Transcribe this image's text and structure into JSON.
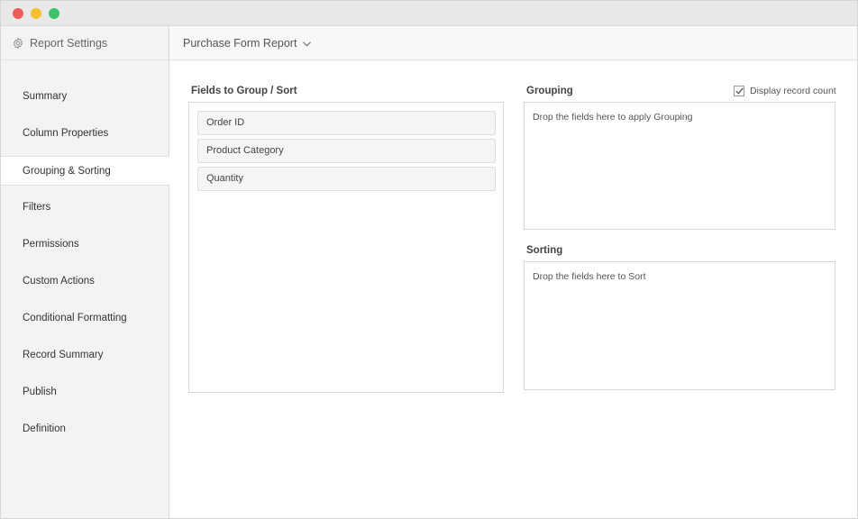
{
  "sidebar": {
    "title": "Report Settings",
    "icon": "gear-icon",
    "items": [
      {
        "label": "Summary"
      },
      {
        "label": "Column Properties"
      },
      {
        "label": "Grouping & Sorting",
        "active": true
      },
      {
        "label": "Filters"
      },
      {
        "label": "Permissions"
      },
      {
        "label": "Custom Actions"
      },
      {
        "label": "Conditional Formatting"
      },
      {
        "label": "Record Summary"
      },
      {
        "label": "Publish"
      },
      {
        "label": "Definition"
      }
    ]
  },
  "header": {
    "report_title": "Purchase Form Report"
  },
  "fields_panel": {
    "title": "Fields to Group / Sort",
    "fields": [
      "Order ID",
      "Product Category",
      "Quantity"
    ]
  },
  "grouping": {
    "title": "Grouping",
    "drop_hint": "Drop the fields here to apply Grouping",
    "display_record_count": {
      "label": "Display record count",
      "checked": true
    }
  },
  "sorting": {
    "title": "Sorting",
    "drop_hint": "Drop the fields here to Sort"
  },
  "colors": {
    "close": "#ee5c55",
    "minimize": "#f5bf2e",
    "maximize": "#3ec36a"
  }
}
